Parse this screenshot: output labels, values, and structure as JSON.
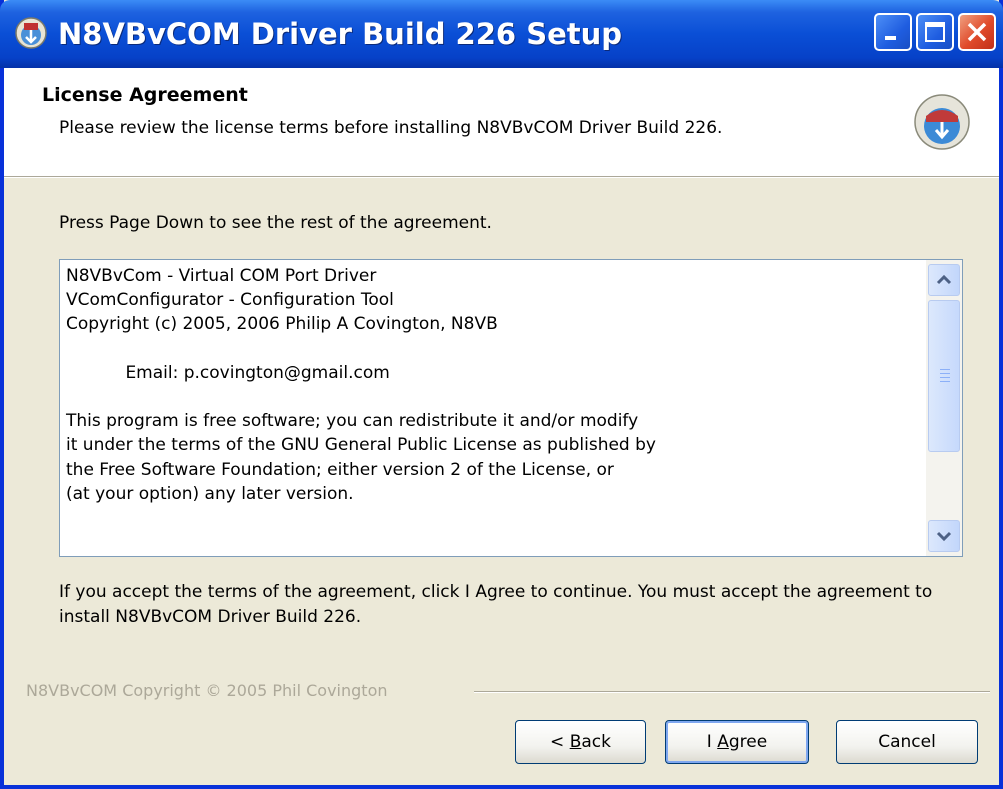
{
  "window": {
    "title": "N8VBvCOM Driver Build 226 Setup",
    "icon": "installer-icon",
    "controls": [
      "minimize-icon",
      "maximize-icon",
      "close-icon"
    ]
  },
  "header": {
    "title": "License Agreement",
    "subtitle": "Please review the license terms before installing N8VBvCOM Driver Build 226.",
    "logo": "installer-logo-icon"
  },
  "instruction": "Press Page Down to see the rest of the agreement.",
  "license_text": "N8VBvCom - Virtual COM Port Driver\nVComConfigurator - Configuration Tool\nCopyright (c) 2005, 2006 Philip A Covington, N8VB\n\n           Email: p.covington@gmail.com\n\nThis program is free software; you can redistribute it and/or modify\nit under the terms of the GNU General Public License as published by\nthe Free Software Foundation; either version 2 of the License, or\n(at your option) any later version.",
  "accept_text": "If you accept the terms of the agreement, click I Agree to continue. You must accept the agreement to install N8VBvCOM Driver Build 226.",
  "branding": "N8VBvCOM Copyright © 2005 Phil Covington",
  "buttons": {
    "back": {
      "pre": "< ",
      "accel": "B",
      "post": "ack"
    },
    "agree": {
      "pre": "I ",
      "accel": "A",
      "post": "gree"
    },
    "cancel": "Cancel"
  },
  "colors": {
    "titlebar": "#0a4fd6",
    "dialog_bg": "#ece9d8",
    "scrollbar": "#c2d6fb"
  }
}
